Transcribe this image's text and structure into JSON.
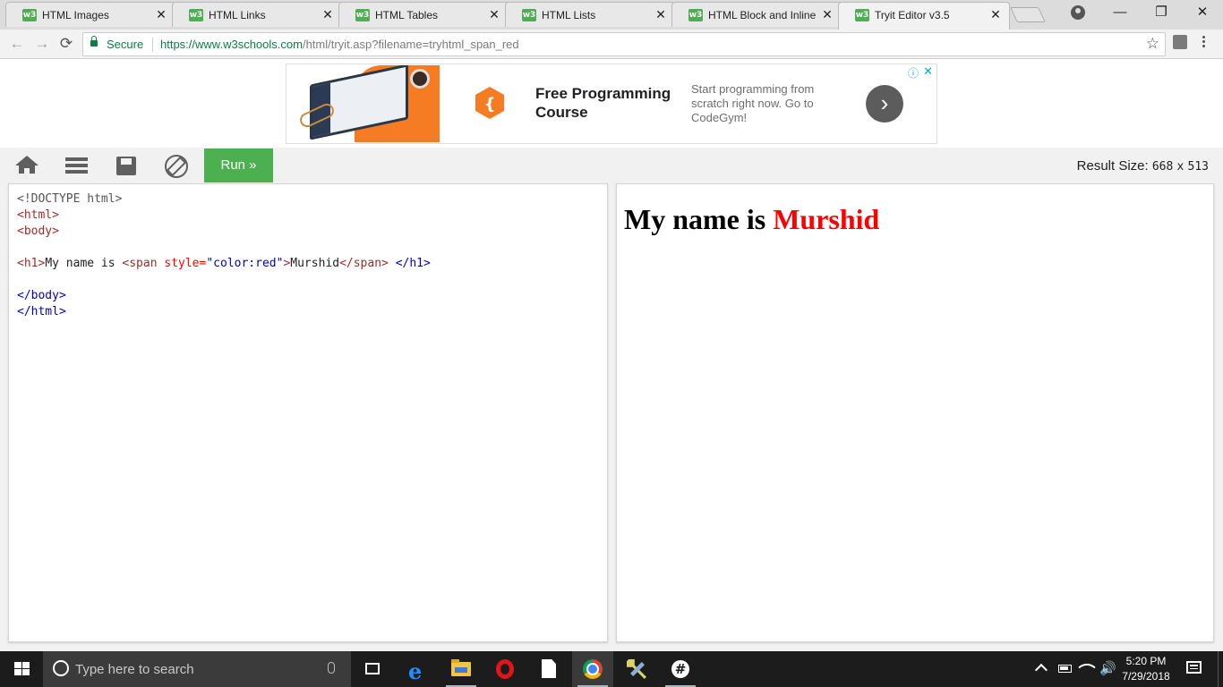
{
  "browser": {
    "tabs": [
      {
        "title": "HTML Images",
        "favicon": "w3"
      },
      {
        "title": "HTML Links",
        "favicon": "w3"
      },
      {
        "title": "HTML Tables",
        "favicon": "w3"
      },
      {
        "title": "HTML Lists",
        "favicon": "w3"
      },
      {
        "title": "HTML Block and Inline E",
        "favicon": "w3"
      },
      {
        "title": "Tryit Editor v3.5",
        "favicon": "w3",
        "active": true
      }
    ],
    "tab_close": "✕",
    "window_controls": {
      "minimize": "—",
      "restore": "❐",
      "close": "✕"
    },
    "nav": {
      "back": "←",
      "forward": "→",
      "reload": "⟳"
    },
    "address": {
      "secure_label": "Secure",
      "url_host": "https://www.w3schools.com",
      "url_path": "/html/tryit.asp?filename=tryhtml_span_red"
    },
    "bookmark_star": "☆"
  },
  "ad": {
    "title": "Free Programming Course",
    "description": "Start programming from scratch right now. Go to CodeGym!",
    "cta": "›",
    "info": "ⓘ",
    "close": "✕",
    "logo_color": "#f57c22"
  },
  "tryit": {
    "run_label": "Run »",
    "result_size_label": "Result Size:",
    "result_width": "668",
    "result_x": "x",
    "result_height": "513",
    "accent_color": "#4caf50"
  },
  "code": {
    "line1": "<!DOCTYPE html>",
    "html_open": "<html>",
    "body_open": "<body>",
    "h1_open": "<h1>",
    "h1_text_before": "My name is ",
    "span_open_start": "<span",
    "span_attr": " style=",
    "span_attr_value": "\"color:red\"",
    "span_open_end": ">",
    "span_text": "Murshid",
    "span_close": "</span>",
    "space": " ",
    "h1_close": "</h1>",
    "body_close": "</body>",
    "html_close": "</html>"
  },
  "result": {
    "text_before": "My name is ",
    "highlighted": "Murshid",
    "highlight_color": "#ff0000"
  },
  "taskbar": {
    "search_placeholder": "Type here to search",
    "time": "5:20 PM",
    "date": "7/29/2018",
    "volume": "🔊",
    "slack_glyph": "#"
  }
}
